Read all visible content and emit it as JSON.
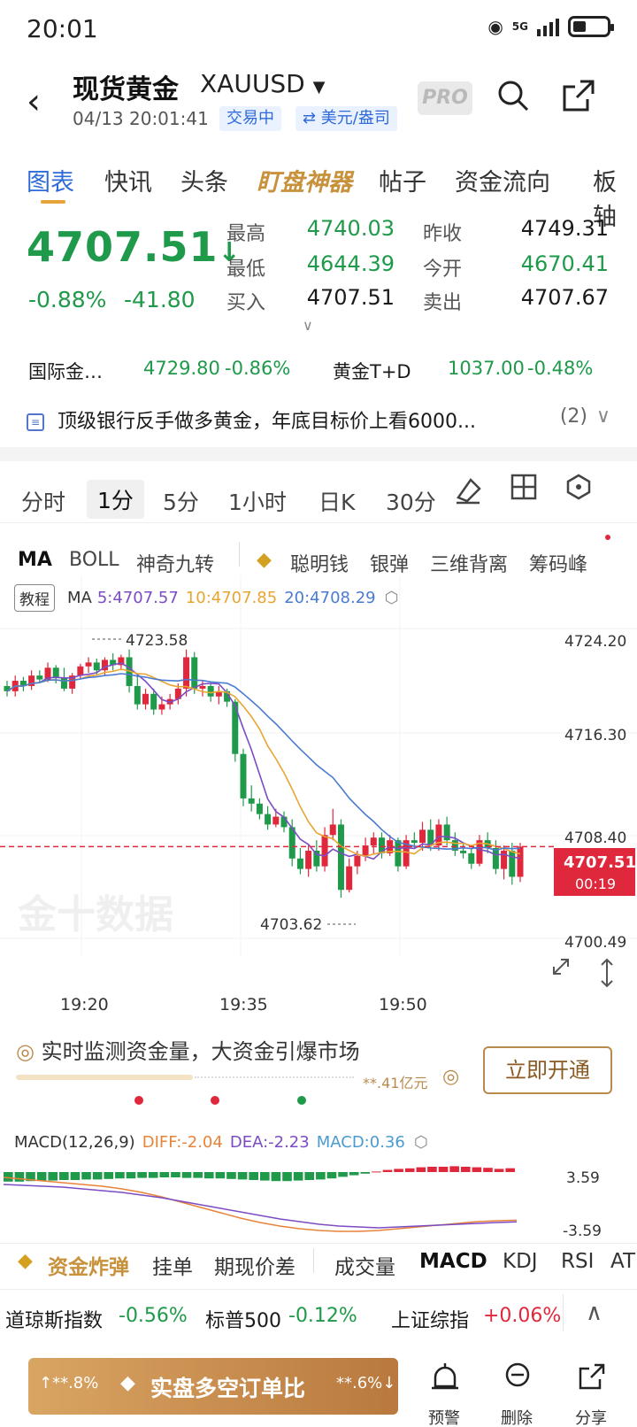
{
  "status": {
    "time": "20:01",
    "network": "5G"
  },
  "header": {
    "title": "现货黄金",
    "symbol": "XAUUSD",
    "timestamp": "04/13 20:01:41",
    "trading_chip": "交易中",
    "unit_chip": "⇄ 美元/盎司",
    "pro": "PRO"
  },
  "tabs": [
    "图表",
    "快讯",
    "头条",
    "盯盘神器",
    "帖子",
    "资金流向",
    "板轴"
  ],
  "quote": {
    "price": "4707.51",
    "change_pct": "-0.88%",
    "change": "-41.80",
    "high_label": "最高",
    "high": "4740.03",
    "low_label": "最低",
    "low": "4644.39",
    "bid_label": "买入",
    "bid": "4707.51",
    "prev_label": "昨收",
    "prev": "4749.31",
    "open_label": "今开",
    "open": "4670.41",
    "ask_label": "卖出",
    "ask": "4707.67"
  },
  "related": [
    {
      "name": "国际金…",
      "price": "4729.80",
      "pct": "-0.86%"
    },
    {
      "name": "黄金T+D",
      "price": "1037.00",
      "pct": "-0.48%"
    }
  ],
  "news": {
    "text": "顶级银行反手做多黄金，年底目标价上看6000...",
    "count": "(2)"
  },
  "periods": [
    "分时",
    "1分",
    "5分",
    "1小时",
    "日K",
    "30分"
  ],
  "indicators": [
    "MA",
    "BOLL",
    "神奇九转",
    "聪明钱",
    "银弹",
    "三维背离",
    "筹码峰"
  ],
  "ma_legend": {
    "lesson": "教程",
    "ma": "MA",
    "ma5": "5:4707.57",
    "ma10": "10:4707.85",
    "ma20": "20:4708.29"
  },
  "chart_axis": {
    "prices": [
      "4724.20",
      "4716.30",
      "4708.40",
      "4700.49"
    ],
    "times": [
      "19:20",
      "19:35",
      "19:50"
    ],
    "high_marker": "4723.58",
    "low_marker": "4703.62",
    "last_price": "4707.51",
    "countdown": "00:19",
    "watermark": "金十数据"
  },
  "promo": {
    "title": "实时监测资金量，大资金引爆市场",
    "amount": "**.41亿元",
    "button": "立即开通"
  },
  "macd": {
    "label": "MACD(12,26,9)",
    "diff": "DIFF:-2.04",
    "dea": "DEA:-2.23",
    "macd": "MACD:0.36",
    "top": "3.59",
    "bottom": "-3.59"
  },
  "bottom_tabs": [
    "资金炸弹",
    "挂单",
    "期现价差",
    "成交量",
    "MACD",
    "KDJ",
    "RSI",
    "AT"
  ],
  "indices": [
    {
      "name": "道琼斯指数",
      "pct": "-0.56%"
    },
    {
      "name": "标普500",
      "pct": "-0.12%"
    },
    {
      "name": "上证综指",
      "pct": "+0.06%"
    }
  ],
  "cta": {
    "left": "↑**.8%",
    "center": "实盘多空订单比",
    "right": "**.6%↓"
  },
  "actions": [
    "预警",
    "删除",
    "分享"
  ],
  "chart_data": {
    "type": "candlestick",
    "title": "",
    "ylim": [
      4700.49,
      4724.2
    ],
    "last": 4707.51,
    "ma5": 4707.57,
    "ma10": 4707.85,
    "ma20": 4708.29,
    "candles": [
      [
        4719.8,
        4720.2,
        4719.0,
        4719.4
      ],
      [
        4719.4,
        4720.6,
        4719.0,
        4720.2
      ],
      [
        4720.2,
        4720.5,
        4719.4,
        4719.8
      ],
      [
        4719.8,
        4721.0,
        4719.5,
        4720.6
      ],
      [
        4720.6,
        4721.0,
        4720.0,
        4720.3
      ],
      [
        4720.3,
        4721.6,
        4720.1,
        4721.2
      ],
      [
        4721.2,
        4721.4,
        4720.0,
        4720.4
      ],
      [
        4720.4,
        4721.2,
        4719.4,
        4719.6
      ],
      [
        4719.6,
        4720.8,
        4719.2,
        4720.6
      ],
      [
        4720.6,
        4721.5,
        4720.3,
        4721.3
      ],
      [
        4721.3,
        4722.0,
        4720.8,
        4721.6
      ],
      [
        4721.6,
        4721.9,
        4720.7,
        4721.0
      ],
      [
        4721.0,
        4722.0,
        4720.6,
        4721.8
      ],
      [
        4721.8,
        4722.3,
        4721.0,
        4721.4
      ],
      [
        4721.4,
        4722.2,
        4721.0,
        4722.0
      ],
      [
        4722.0,
        4722.6,
        4719.3,
        4719.8
      ],
      [
        4719.8,
        4720.6,
        4718.0,
        4718.4
      ],
      [
        4718.4,
        4719.6,
        4718.0,
        4719.2
      ],
      [
        4719.2,
        4719.6,
        4717.6,
        4718.0
      ],
      [
        4718.0,
        4719.0,
        4717.6,
        4718.4
      ],
      [
        4718.4,
        4719.2,
        4718.0,
        4718.8
      ],
      [
        4718.8,
        4720.0,
        4718.4,
        4719.6
      ],
      [
        4719.6,
        4722.6,
        4719.0,
        4722.0
      ],
      [
        4722.0,
        4722.4,
        4719.2,
        4719.6
      ],
      [
        4719.6,
        4720.2,
        4719.0,
        4719.8
      ],
      [
        4719.8,
        4720.0,
        4718.6,
        4719.0
      ],
      [
        4719.0,
        4719.8,
        4718.4,
        4719.4
      ],
      [
        4719.4,
        4719.6,
        4718.2,
        4718.6
      ],
      [
        4718.6,
        4718.8,
        4714.0,
        4714.6
      ],
      [
        4714.6,
        4715.0,
        4710.6,
        4711.2
      ],
      [
        4711.2,
        4712.2,
        4710.2,
        4710.8
      ],
      [
        4710.8,
        4711.2,
        4709.6,
        4710.0
      ],
      [
        4710.0,
        4710.6,
        4708.8,
        4709.2
      ],
      [
        4709.2,
        4710.4,
        4709.0,
        4709.8
      ],
      [
        4709.8,
        4710.2,
        4708.6,
        4709.0
      ],
      [
        4709.0,
        4709.6,
        4706.0,
        4706.6
      ],
      [
        4706.6,
        4707.4,
        4705.4,
        4705.8
      ],
      [
        4705.8,
        4707.6,
        4705.2,
        4707.2
      ],
      [
        4707.2,
        4708.0,
        4705.6,
        4706.0
      ],
      [
        4706.0,
        4709.0,
        4705.6,
        4708.4
      ],
      [
        4708.4,
        4710.4,
        4708.0,
        4709.2
      ],
      [
        4709.2,
        4709.6,
        4703.6,
        4704.2
      ],
      [
        4704.2,
        4706.6,
        4704.0,
        4706.0
      ],
      [
        4706.0,
        4707.2,
        4705.4,
        4706.8
      ],
      [
        4706.8,
        4708.2,
        4706.4,
        4707.6
      ],
      [
        4707.6,
        4708.6,
        4707.0,
        4708.2
      ],
      [
        4708.2,
        4708.6,
        4706.6,
        4707.0
      ],
      [
        4707.0,
        4708.4,
        4706.8,
        4708.0
      ],
      [
        4708.0,
        4708.2,
        4705.6,
        4706.0
      ],
      [
        4706.0,
        4708.4,
        4705.8,
        4708.0
      ],
      [
        4708.0,
        4708.6,
        4707.4,
        4707.8
      ],
      [
        4707.8,
        4709.4,
        4707.2,
        4708.8
      ],
      [
        4708.8,
        4709.6,
        4707.2,
        4707.6
      ],
      [
        4707.6,
        4709.6,
        4707.2,
        4709.2
      ],
      [
        4709.2,
        4709.8,
        4707.6,
        4708.0
      ],
      [
        4708.0,
        4708.6,
        4706.8,
        4707.2
      ],
      [
        4707.2,
        4707.8,
        4706.6,
        4707.0
      ],
      [
        4707.0,
        4707.4,
        4705.8,
        4706.2
      ],
      [
        4706.2,
        4708.4,
        4706.0,
        4708.0
      ],
      [
        4708.0,
        4708.6,
        4707.0,
        4707.4
      ],
      [
        4707.4,
        4708.0,
        4705.4,
        4705.8
      ],
      [
        4705.8,
        4707.6,
        4705.0,
        4707.2
      ],
      [
        4707.2,
        4707.8,
        4704.6,
        4705.2
      ],
      [
        4705.2,
        4707.8,
        4704.8,
        4707.51
      ]
    ],
    "macd_hist": [
      -0.9,
      -0.9,
      -0.85,
      -0.8,
      -0.8,
      -0.75,
      -0.75,
      -0.7,
      -0.7,
      -0.65,
      -0.6,
      -0.6,
      -0.55,
      -0.55,
      -0.5,
      -0.5,
      -0.55,
      -0.55,
      -0.6,
      -0.6,
      -0.65,
      -0.7,
      -0.75,
      -0.8,
      -0.85,
      -0.85,
      -0.8,
      -0.75,
      -0.7,
      -0.6,
      -0.45,
      -0.3,
      -0.15,
      0.05,
      0.2,
      0.3,
      0.35,
      0.45,
      0.5,
      0.5,
      0.55,
      0.5,
      0.45,
      0.4,
      0.3,
      0.36
    ],
    "diff_line": [
      2.8,
      2.6,
      2.4,
      2.2,
      2.0,
      1.8,
      1.5,
      1.1,
      0.6,
      0.0,
      -0.6,
      -1.2,
      -1.8,
      -2.3,
      -2.7,
      -3.0,
      -3.2,
      -3.3,
      -3.3,
      -3.2,
      -3.0,
      -2.8,
      -2.6,
      -2.4,
      -2.2,
      -2.1,
      -2.04
    ],
    "dea_line": [
      2.0,
      1.9,
      1.8,
      1.7,
      1.5,
      1.3,
      1.1,
      0.8,
      0.5,
      0.1,
      -0.3,
      -0.7,
      -1.1,
      -1.5,
      -1.9,
      -2.2,
      -2.5,
      -2.7,
      -2.8,
      -2.9,
      -2.8,
      -2.7,
      -2.6,
      -2.5,
      -2.4,
      -2.3,
      -2.23
    ]
  }
}
